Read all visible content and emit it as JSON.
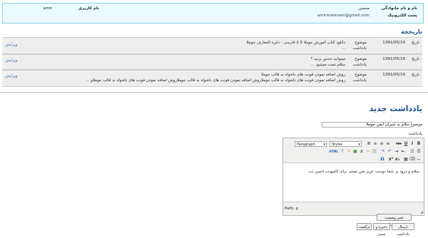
{
  "user": {
    "name_label": "نام و نام خانوادگی",
    "name_value": "محسن",
    "username_label": "نام کاربری",
    "username_value": "amir",
    "email_label": "پست الکترونیک",
    "email_value": "amirsoleimani@gmail.com"
  },
  "history": {
    "title": "تاریخچه",
    "date_label": "تاریخ",
    "subject_label": "موضوع",
    "note_label": "یادداشت",
    "edit_label": "ویرایش",
    "items": [
      {
        "date": "1391/05/19",
        "subject": "دانلود کتاب آموزش جوملا 2.5 فارسی - دایره المعارف جوملا",
        "note": "..."
      },
      {
        "date": "1391/05/19",
        "subject": "میتوانید حدس بزنید ؟",
        "note": "سلام تست میشود ..."
      },
      {
        "date": "1391/05/19",
        "subject": "روش اضافه نمودن فونت های دلخواه به قالب جوملا",
        "note": "روش اضافه نمودن فونت های دلخواه به قالب جوملاروش اضافه نمودن فونت های دلخواه به قالب جوملاروش اضافه نمودن فونت های دلخواه به قالب جوملاو ..."
      }
    ]
  },
  "new_note": {
    "title": "یادداشت جدید",
    "subject_label": "موضوع",
    "subject_value": "سلام به شیران ایمن جوملا",
    "note_label": "یادداشت",
    "styles_select": "Styles",
    "format_select": "Paragraph",
    "html_label": "HTML",
    "body_text": "سلام و درود بر شما دوست عزیز متن تستی برای کامپونت ادمین نت",
    "path_text": "Path: p",
    "toggle_editor_button": "تغییر وضعیت ویرایشگر",
    "send_button": "ارسال یادداشت",
    "save_close_button": "ذخیره و بستن",
    "back_button": "برگشت"
  },
  "colors": {
    "title_blue": "#1a4f8a",
    "userbox_border": "#7fd4e0",
    "userbox_bg": "#eafafd",
    "link_blue": "#3366aa"
  },
  "icons": [
    "bold-icon",
    "italic-icon",
    "underline-icon",
    "strikethrough-icon",
    "align-left-icon",
    "align-center-icon",
    "align-right-icon",
    "align-justify-icon",
    "bullet-list-icon",
    "numbered-list-icon",
    "outdent-icon",
    "indent-icon",
    "undo-icon",
    "redo-icon",
    "link-icon",
    "unlink-icon",
    "anchor-icon",
    "image-icon",
    "cleanup-icon",
    "help-icon",
    "html-icon",
    "horizontal-rule-icon",
    "remove-format-icon",
    "visual-aid-icon",
    "subscript-icon",
    "superscript-icon",
    "special-char-icon",
    "resize-handle-icon"
  ]
}
